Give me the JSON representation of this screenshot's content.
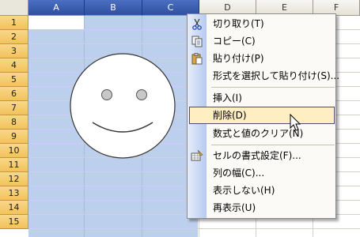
{
  "columns": [
    "A",
    "B",
    "C",
    "D",
    "E",
    "F"
  ],
  "selected_columns": [
    "A",
    "B",
    "C"
  ],
  "rows": [
    "1",
    "2",
    "3",
    "4",
    "5",
    "6",
    "7",
    "8",
    "9",
    "10",
    "11",
    "12",
    "13",
    "14",
    "15"
  ],
  "active_cell": "A1",
  "colors": {
    "selection": "#bccfec",
    "column_header_selected": "#2f4f9f",
    "row_header": "#f3c25a",
    "menu_highlight": "#ffeec2"
  },
  "context_menu": {
    "items": [
      {
        "label": "切り取り(T)",
        "icon": "scissors-icon"
      },
      {
        "label": "コピー(C)",
        "icon": "copy-icon"
      },
      {
        "label": "貼り付け(P)",
        "icon": "paste-icon"
      },
      {
        "label": "形式を選択して貼り付け(S)..."
      },
      {
        "label": "挿入(I)"
      },
      {
        "label": "削除(D)",
        "highlighted": true
      },
      {
        "label": "数式と値のクリア(N)"
      },
      {
        "label": "セルの書式設定(F)...",
        "icon": "format-cells-icon"
      },
      {
        "label": "列の幅(C)..."
      },
      {
        "label": "表示しない(H)"
      },
      {
        "label": "再表示(U)"
      }
    ]
  }
}
